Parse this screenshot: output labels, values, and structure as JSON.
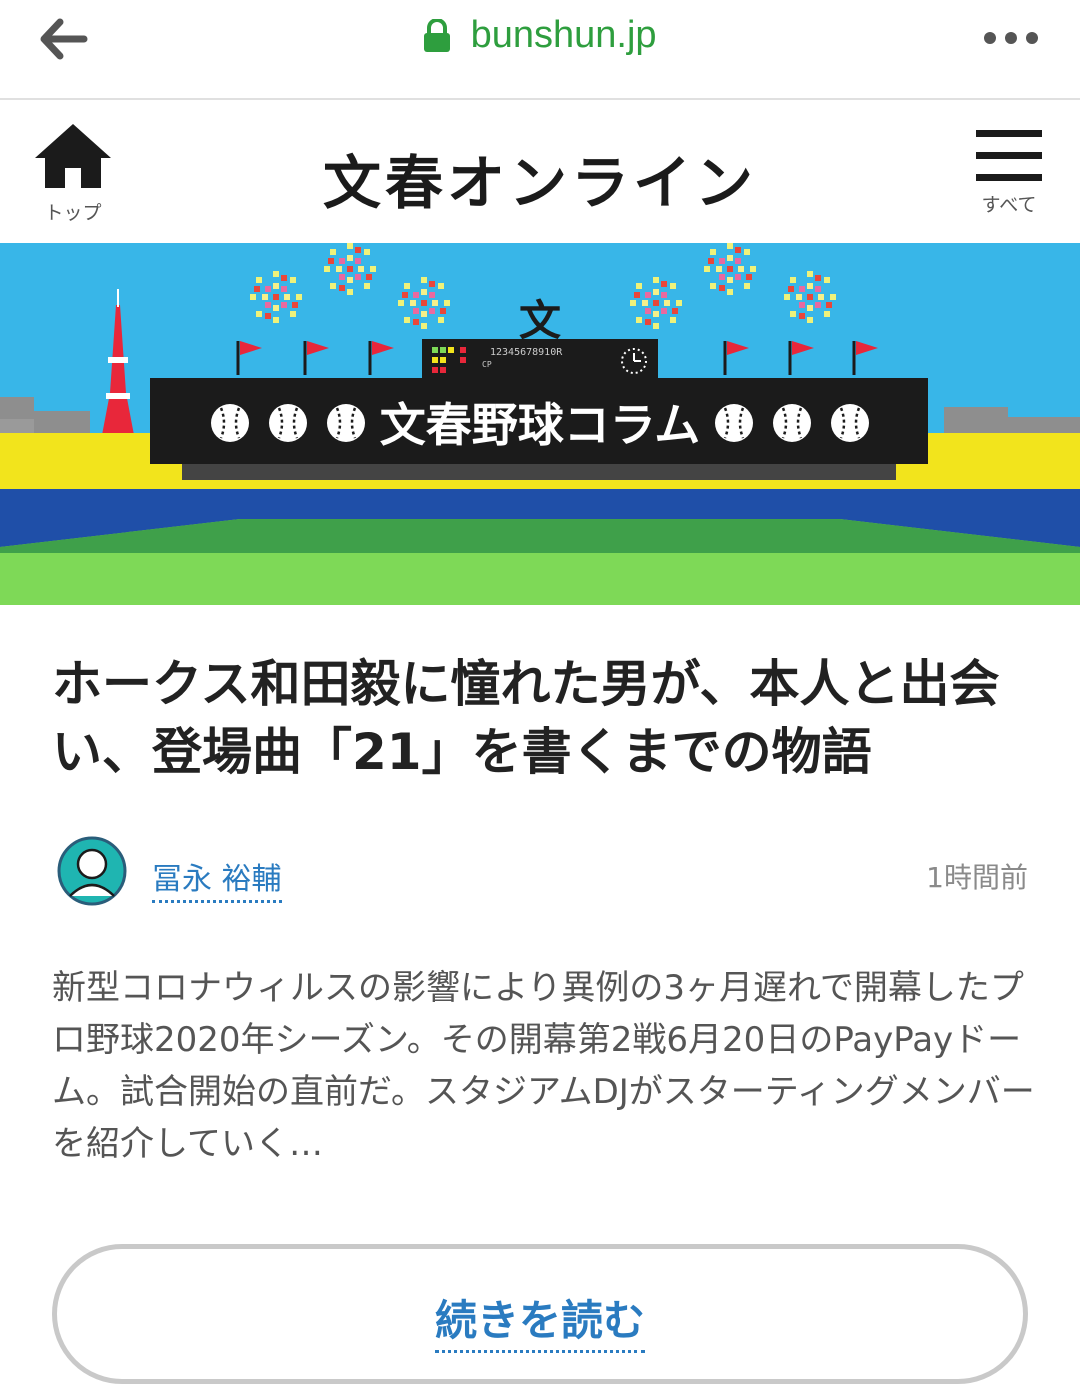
{
  "browser": {
    "url": "bunshun.jp",
    "back_icon": "arrow-left-icon",
    "lock_icon": "lock-icon",
    "more_icon": "more-dots-icon",
    "url_color": "#2e9e3e"
  },
  "site_header": {
    "logo": "文春オンライン",
    "home_label": "トップ",
    "menu_label": "すべて"
  },
  "banner": {
    "title": "文春野球コラム",
    "scoreboard_numbers": "12345678910R",
    "scoreboard_rows": "CP",
    "emblem": "文"
  },
  "article": {
    "title": "ホークス和田毅に憧れた男が、本人と出会い、登場曲「21」を書くまでの物語",
    "author": "冨永 裕輔",
    "time_ago": "1時間前",
    "lead": "新型コロナウィルスの影響により異例の3ヶ月遅れで開幕したプロ野球2020年シーズン。その開幕第2戦6月20日のPayPayドーム。試合開始の直前だ。スタジアムDJがスターティングメンバーを紹介していく…",
    "read_more": "続きを読む"
  },
  "colors": {
    "link": "#2a7bc0",
    "sky": "#38b6e8",
    "stand_yellow": "#f2e41c",
    "river_blue": "#1f4fa8",
    "field_green": "#7ed957"
  }
}
